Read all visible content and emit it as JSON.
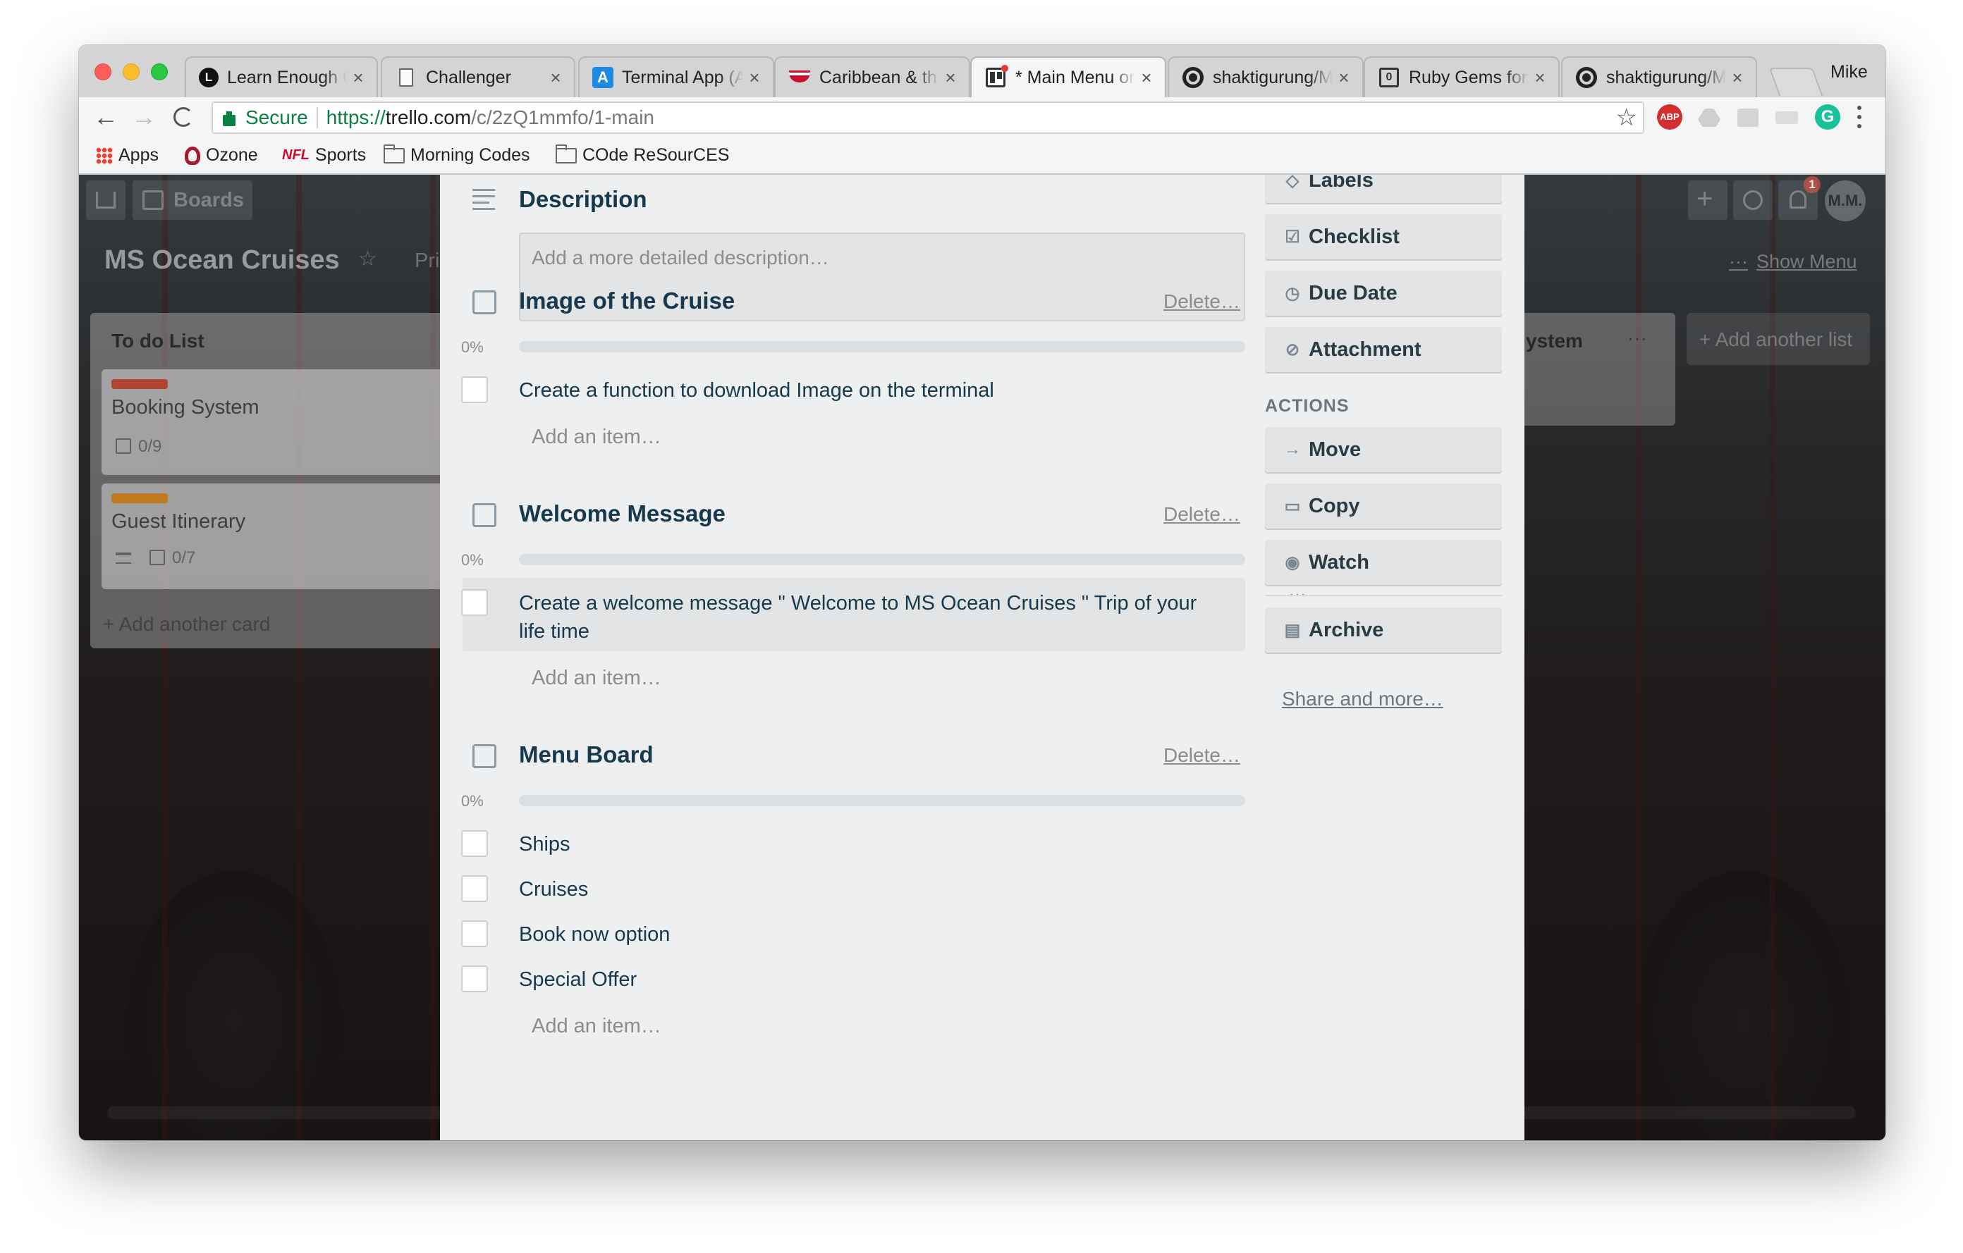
{
  "browser": {
    "profile_name": "Mike",
    "tabs": [
      {
        "title": "Learn Enough C",
        "icon": "learn-enough-icon",
        "close": "×"
      },
      {
        "title": "Challenger",
        "icon": "document-icon",
        "close": "×"
      },
      {
        "title": "Terminal App (A",
        "icon": "terminal-app-icon",
        "close": "×"
      },
      {
        "title": "Caribbean & th",
        "icon": "cruise-line-icon",
        "close": "×"
      },
      {
        "title": "* Main Menu or",
        "icon": "trello-icon",
        "close": "×"
      },
      {
        "title": "shaktigurung/M",
        "icon": "github-icon",
        "close": "×"
      },
      {
        "title": "Ruby Gems for",
        "icon": "rubygems-icon",
        "close": "×"
      },
      {
        "title": "shaktigurung/M",
        "icon": "github-icon",
        "close": "×"
      }
    ],
    "address": {
      "secure_label": "Secure",
      "scheme": "https://",
      "host": "trello.com",
      "path": "/c/2zQ1mmfo/1-main"
    },
    "bookmarks": [
      {
        "label": "Apps",
        "icon": "apps-grid-icon"
      },
      {
        "label": "Ozone",
        "icon": "ozone-icon"
      },
      {
        "label": "Sports",
        "icon": "nfl-icon",
        "prefix": "NFL"
      },
      {
        "label": "Morning Codes",
        "icon": "folder-icon"
      },
      {
        "label": "COde ReSourCES",
        "icon": "folder-icon"
      }
    ],
    "extensions": {
      "adblock": "ABP",
      "grammarly": "G"
    }
  },
  "board": {
    "nav_boards": "Boards",
    "title": "MS Ocean Cruises",
    "visibility_partial": "Pri",
    "show_menu": "Show Menu",
    "avatar_initials": "M.M.",
    "notification_count": "1",
    "list": {
      "title": "To do List",
      "cards": [
        {
          "label_color": "#b04632",
          "title": "Booking System",
          "checklist": "0/9"
        },
        {
          "label_color": "#c07a1f",
          "title": "Guest Itinerary",
          "checklist": "0/7"
        }
      ],
      "add_card": "+ Add another card"
    },
    "second_list_title_partial": "ystem",
    "add_another_list": "+ Add another list"
  },
  "card_detail": {
    "description": {
      "heading": "Description",
      "placeholder": "Add a more detailed description…"
    },
    "checklists": [
      {
        "title": "Image of the Cruise",
        "delete": "Delete…",
        "percent": "0%",
        "progress": 0,
        "items": [
          "Create a function to download Image on the terminal"
        ],
        "add_item": "Add an item…"
      },
      {
        "title": "Welcome Message",
        "delete": "Delete…",
        "percent": "0%",
        "progress": 0,
        "items": [
          "Create a welcome message \" Welcome to MS Ocean Cruises \" Trip of your",
          "life time"
        ],
        "item_menu": "···",
        "add_item": "Add an item…"
      },
      {
        "title": "Menu Board",
        "delete": "Delete…",
        "percent": "0%",
        "progress": 0,
        "items": [
          "Ships",
          "Cruises",
          "Book now option",
          "Special Offer"
        ],
        "add_item": "Add an item…"
      }
    ],
    "sidebar": {
      "add_buttons": [
        {
          "label": "Labels",
          "icon": "label-icon"
        },
        {
          "label": "Checklist",
          "icon": "checklist-icon"
        },
        {
          "label": "Due Date",
          "icon": "clock-icon"
        },
        {
          "label": "Attachment",
          "icon": "paperclip-icon"
        }
      ],
      "actions_heading": "ACTIONS",
      "action_buttons": [
        {
          "label": "Move",
          "icon": "arrow-right-icon"
        },
        {
          "label": "Copy",
          "icon": "copy-icon"
        },
        {
          "label": "Watch",
          "icon": "eye-icon"
        },
        {
          "label": "Archive",
          "icon": "archive-icon"
        }
      ],
      "share": "Share and more…"
    }
  }
}
